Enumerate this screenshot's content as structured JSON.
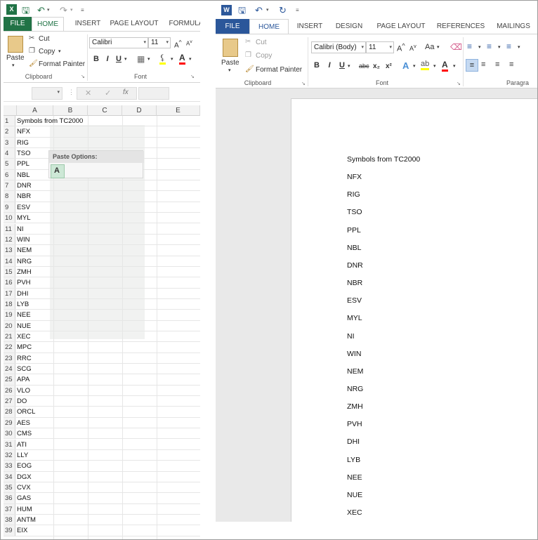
{
  "excel": {
    "tabs": [
      "FILE",
      "HOME",
      "INSERT",
      "PAGE LAYOUT",
      "FORMULA"
    ],
    "clipboard": {
      "cut": "Cut",
      "copy": "Copy",
      "format_painter": "Format Painter",
      "paste": "Paste",
      "group_label": "Clipboard"
    },
    "font": {
      "family": "Calibri",
      "size": "11",
      "bold": "B",
      "italic": "I",
      "underline": "U",
      "group_label": "Font"
    },
    "formula_bar": {
      "fx": "fx"
    },
    "columns": [
      "A",
      "B",
      "C",
      "D",
      "E"
    ],
    "paste_options_label": "Paste Options:",
    "rows": [
      {
        "num": "1",
        "value": "Symbols from TC2000"
      },
      {
        "num": "2",
        "value": "NFX"
      },
      {
        "num": "3",
        "value": "RIG"
      },
      {
        "num": "4",
        "value": "TSO"
      },
      {
        "num": "5",
        "value": "PPL"
      },
      {
        "num": "6",
        "value": "NBL"
      },
      {
        "num": "7",
        "value": "DNR"
      },
      {
        "num": "8",
        "value": "NBR"
      },
      {
        "num": "9",
        "value": "ESV"
      },
      {
        "num": "10",
        "value": "MYL"
      },
      {
        "num": "11",
        "value": "NI"
      },
      {
        "num": "12",
        "value": "WIN"
      },
      {
        "num": "13",
        "value": "NEM"
      },
      {
        "num": "14",
        "value": "NRG"
      },
      {
        "num": "15",
        "value": "ZMH"
      },
      {
        "num": "16",
        "value": "PVH"
      },
      {
        "num": "17",
        "value": "DHI"
      },
      {
        "num": "18",
        "value": "LYB"
      },
      {
        "num": "19",
        "value": "NEE"
      },
      {
        "num": "20",
        "value": "NUE"
      },
      {
        "num": "21",
        "value": "XEC"
      },
      {
        "num": "22",
        "value": "MPC"
      },
      {
        "num": "23",
        "value": "RRC"
      },
      {
        "num": "24",
        "value": "SCG"
      },
      {
        "num": "25",
        "value": "APA"
      },
      {
        "num": "26",
        "value": "VLO"
      },
      {
        "num": "27",
        "value": "DO"
      },
      {
        "num": "28",
        "value": "ORCL"
      },
      {
        "num": "29",
        "value": "AES"
      },
      {
        "num": "30",
        "value": "CMS"
      },
      {
        "num": "31",
        "value": "ATI"
      },
      {
        "num": "32",
        "value": "LLY"
      },
      {
        "num": "33",
        "value": "EOG"
      },
      {
        "num": "34",
        "value": "DGX"
      },
      {
        "num": "35",
        "value": "CVX"
      },
      {
        "num": "36",
        "value": "GAS"
      },
      {
        "num": "37",
        "value": "HUM"
      },
      {
        "num": "38",
        "value": "ANTM"
      },
      {
        "num": "39",
        "value": "EIX"
      }
    ]
  },
  "word": {
    "tabs": [
      "FILE",
      "HOME",
      "INSERT",
      "DESIGN",
      "PAGE LAYOUT",
      "REFERENCES",
      "MAILINGS"
    ],
    "clipboard": {
      "cut": "Cut",
      "copy": "Copy",
      "format_painter": "Format Painter",
      "paste": "Paste",
      "group_label": "Clipboard"
    },
    "font": {
      "family": "Calibri (Body)",
      "size": "11",
      "change_case": "Aa",
      "bold": "B",
      "italic": "I",
      "underline": "U",
      "strike": "abc",
      "subscript": "x₂",
      "superscript": "x²",
      "group_label": "Font"
    },
    "paragraph_group_label": "Paragra",
    "document": [
      "Symbols from TC2000",
      "NFX",
      "RIG",
      "TSO",
      "PPL",
      "NBL",
      "DNR",
      "NBR",
      "ESV",
      "MYL",
      "NI",
      "WIN",
      "NEM",
      "NRG",
      "ZMH",
      "PVH",
      "DHI",
      "LYB",
      "NEE",
      "NUE",
      "XEC"
    ]
  },
  "colors": {
    "excel_green": "#217346",
    "word_blue": "#2b579a"
  }
}
